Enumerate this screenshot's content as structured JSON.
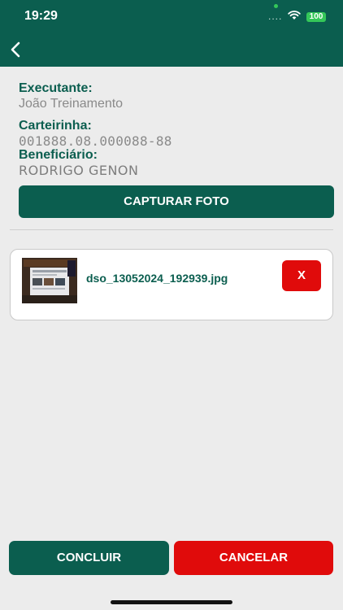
{
  "status_bar": {
    "time": "19:29",
    "signal": "....",
    "battery": "100"
  },
  "fields": {
    "executante_label": "Executante:",
    "executante_value": "João Treinamento",
    "carteirinha_label": "Carteirinha:",
    "carteirinha_value": "001888.08.000088-88",
    "beneficiario_label": "Beneficiário:",
    "beneficiario_value": "RODRIGO GENON"
  },
  "actions": {
    "capture_label": "CAPTURAR FOTO",
    "concluir_label": "CONCLUIR",
    "cancelar_label": "CANCELAR"
  },
  "attachment": {
    "filename": "dso_13052024_192939.jpg",
    "remove_label": "X"
  },
  "icons": {
    "back": "back-chevron-icon",
    "wifi": "wifi-icon",
    "battery": "battery-icon"
  },
  "colors": {
    "primary": "#0b5e4f",
    "danger": "#e00b0b",
    "background": "#ececec"
  }
}
